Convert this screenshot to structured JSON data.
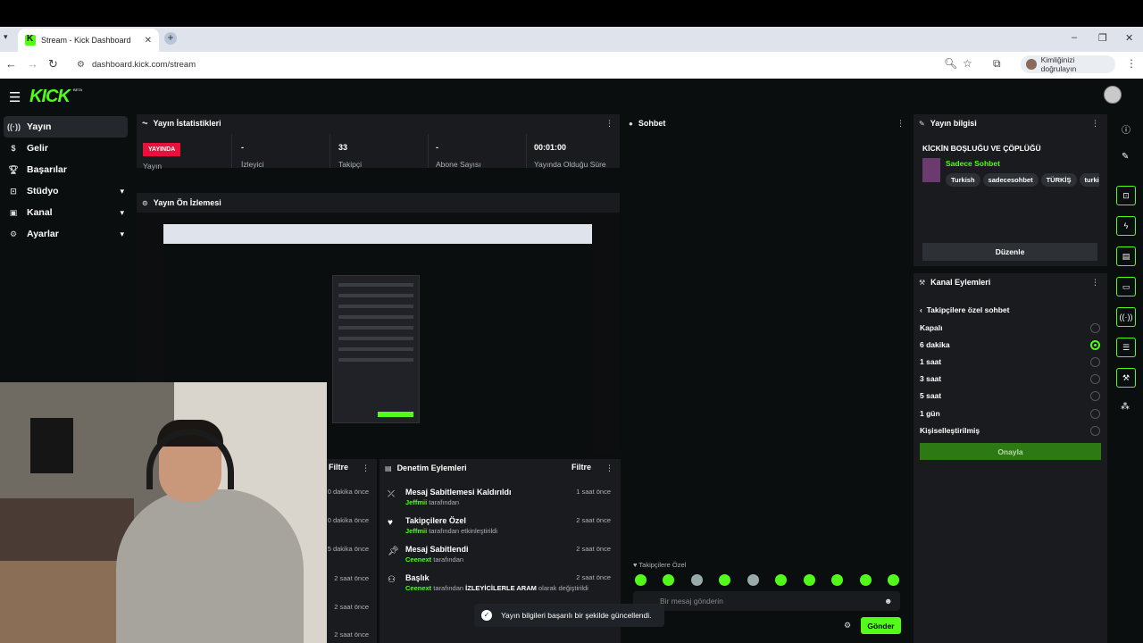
{
  "browser": {
    "tab_title": "Stream - Kick Dashboard",
    "url": "dashboard.kick.com/stream",
    "profile_label": "Kimliğinizi doğrulayın"
  },
  "app": {
    "logo": "KICK",
    "logo_badge": "BETA"
  },
  "sidebar": {
    "items": [
      {
        "label": "Yayın",
        "icon": "broadcast-icon"
      },
      {
        "label": "Gelir",
        "icon": "dollar-icon"
      },
      {
        "label": "Başarılar",
        "icon": "trophy-icon"
      },
      {
        "label": "Stüdyo",
        "icon": "studio-icon"
      },
      {
        "label": "Kanal",
        "icon": "channel-icon"
      },
      {
        "label": "Ayarlar",
        "icon": "gear-icon"
      }
    ]
  },
  "stats": {
    "title": "Yayın İstatistikleri",
    "live_badge": "YAYINDA",
    "items": [
      {
        "value": "",
        "caption": "Yayın"
      },
      {
        "value": "-",
        "caption": "İzleyici"
      },
      {
        "value": "33",
        "caption": "Takipçi"
      },
      {
        "value": "-",
        "caption": "Abone Sayısı"
      },
      {
        "value": "00:01:00",
        "caption": "Yayında Olduğu Süre"
      }
    ]
  },
  "preview": {
    "title": "Yayın Ön İzlemesi"
  },
  "left_log": {
    "filter": "Filtre",
    "times": [
      "0 dakika önce",
      "0 dakika önce",
      "5 dakika önce",
      "2 saat önce",
      "2 saat önce",
      "2 saat önce"
    ]
  },
  "moderation": {
    "title": "Denetim Eylemleri",
    "filter": "Filtre",
    "events": [
      {
        "title": "Mesaj Sabitlemesi Kaldırıldı",
        "user": "Jeffmii",
        "rest": "tarafından",
        "time": "1 saat önce",
        "icon": "unpin-icon"
      },
      {
        "title": "Takipçilere Özel",
        "user": "Jeffmii",
        "rest": "tarafından etkinleştirildi",
        "time": "2 saat önce",
        "icon": "heart-icon"
      },
      {
        "title": "Mesaj Sabitlendi",
        "user": "Ceenext",
        "rest": "tarafından",
        "time": "2 saat önce",
        "icon": "pin-icon"
      },
      {
        "title": "Başlık",
        "user": "Ceenext",
        "rest": "tarafından",
        "highlight": "İZLEYİCİLERLE ARAM",
        "rest2": "olarak değiştirildi",
        "time": "2 saat önce",
        "icon": "title-icon"
      }
    ]
  },
  "chat": {
    "title": "Sohbet",
    "mode_label": "Takipçilere Özel",
    "input_placeholder": "Bir mesaj gönderin",
    "send": "Gönder"
  },
  "toast": {
    "message": "Yayın bilgileri başarılı bir şekilde güncellendi."
  },
  "stream_info": {
    "title": "Yayın bilgisi",
    "stream_title": "KİCKİN BOŞLUĞU VE ÇÖPLÜĞÜ",
    "category": "Sadece Sohbet",
    "tags": [
      "Turkish",
      "sadecesohbet",
      "TÜRKİŞ",
      "turkiye"
    ],
    "edit": "Düzenle"
  },
  "channel_actions": {
    "title": "Kanal Eylemleri",
    "sub_title": "Takipçilere özel sohbet",
    "options": [
      "Kapalı",
      "6 dakika",
      "1 saat",
      "3 saat",
      "5 saat",
      "1 gün",
      "Kişiselleştirilmiş"
    ],
    "selected": "6 dakika",
    "confirm": "Onayla"
  },
  "colors": {
    "accent": "#53fc18",
    "live": "#e9113c",
    "panel": "#191b1f",
    "bg": "#0b0e0f"
  }
}
